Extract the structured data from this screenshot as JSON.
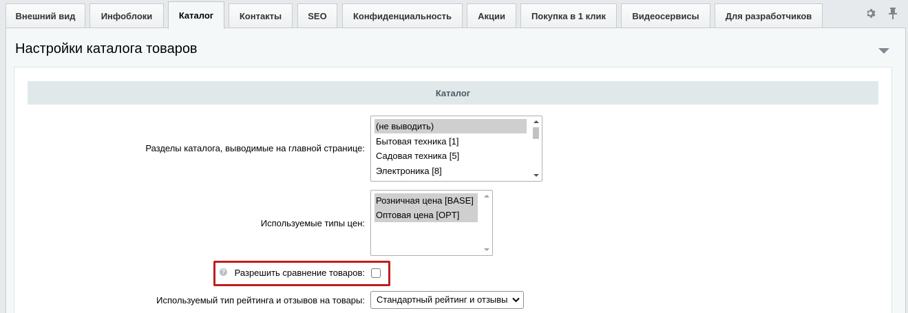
{
  "tabs": [
    {
      "label": "Внешний вид",
      "active": false
    },
    {
      "label": "Инфоблоки",
      "active": false
    },
    {
      "label": "Каталог",
      "active": true
    },
    {
      "label": "Контакты",
      "active": false
    },
    {
      "label": "SEO",
      "active": false
    },
    {
      "label": "Конфиденциальность",
      "active": false
    },
    {
      "label": "Акции",
      "active": false
    },
    {
      "label": "Покупка в 1 клик",
      "active": false
    },
    {
      "label": "Видеосервисы",
      "active": false
    },
    {
      "label": "Для разработчиков",
      "active": false
    }
  ],
  "tools": {
    "settings_icon": "gear-icon",
    "pin_icon": "pin-icon"
  },
  "panel": {
    "title": "Настройки каталога товаров",
    "section_title": "Каталог"
  },
  "fields": {
    "catalog_sections": {
      "label": "Разделы каталога, выводимые на главной странице:",
      "options": [
        {
          "text": "(не выводить)",
          "selected": true
        },
        {
          "text": "Бытовая техника [1]",
          "selected": false
        },
        {
          "text": "Садовая техника [5]",
          "selected": false
        },
        {
          "text": "Электроника [8]",
          "selected": false
        }
      ]
    },
    "price_types": {
      "label": "Используемые типы цен:",
      "options": [
        {
          "text": "Розничная цена [BASE]",
          "selected": true
        },
        {
          "text": "Оптовая цена [OPT]",
          "selected": true
        }
      ]
    },
    "compare": {
      "help": "?",
      "label": "Разрешить сравнение товаров:",
      "checked": false
    },
    "rating_type": {
      "label": "Используемый тип рейтинга и отзывов на товары:",
      "value": "Стандартный рейтинг и отзывы"
    }
  },
  "colors": {
    "highlight": "#c01c1c",
    "section_bg": "#e0e8ea"
  }
}
